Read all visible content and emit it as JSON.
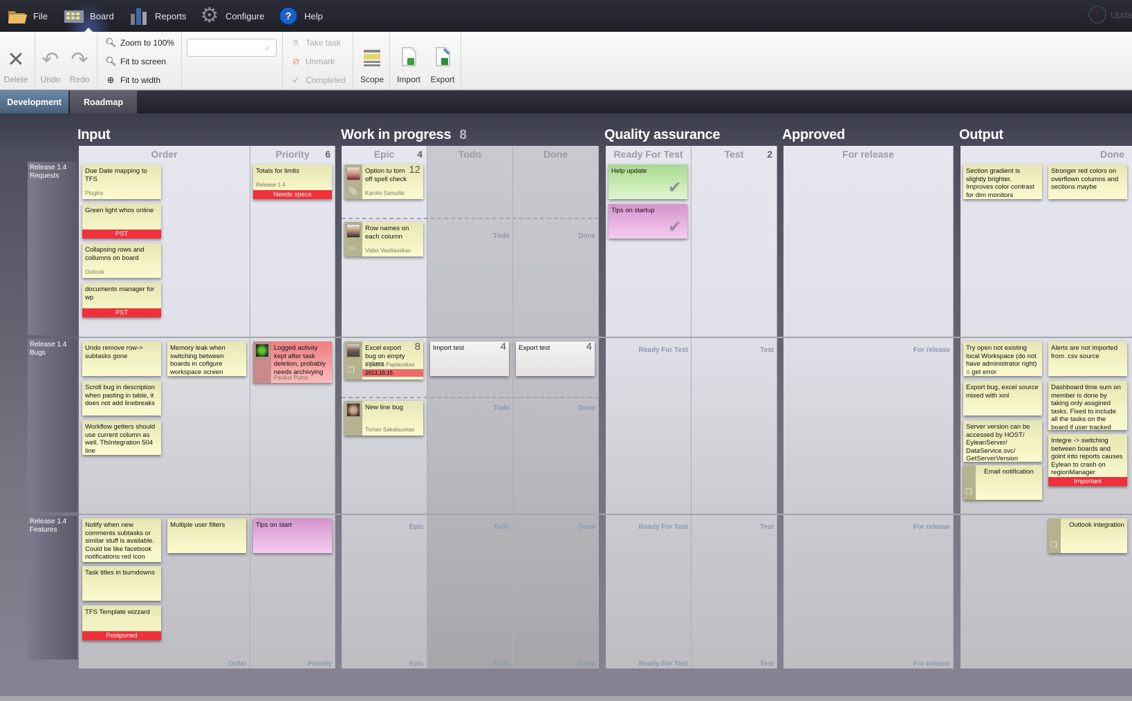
{
  "menu": {
    "items": [
      {
        "label": "File",
        "icon": "folder-icon"
      },
      {
        "label": "Board",
        "icon": "board-icon",
        "active": true
      },
      {
        "label": "Reports",
        "icon": "bar-chart-icon"
      },
      {
        "label": "Configure",
        "icon": "gear-icon"
      },
      {
        "label": "Help",
        "icon": "help-icon"
      }
    ],
    "update_label": "Upda"
  },
  "toolbar": {
    "delete": "Delete",
    "undo": "Undo",
    "redo": "Redo",
    "zoom_100": "Zoom to 100%",
    "fit_screen": "Fit to screen",
    "fit_width": "Fit to width",
    "search_value": "",
    "search_placeholder": "",
    "take_task": "Take task",
    "unmark": "Unmark",
    "completed": "Completed",
    "scope": "Scope",
    "import": "Import",
    "export": "Export"
  },
  "tabs": [
    {
      "label": "Development",
      "active": true
    },
    {
      "label": "Roadmap",
      "active": false
    }
  ],
  "board": {
    "groups": [
      {
        "title": "Input",
        "count": ""
      },
      {
        "title": "Work in progress",
        "count": "8"
      },
      {
        "title": "Quality assurance",
        "count": ""
      },
      {
        "title": "Approved",
        "count": ""
      },
      {
        "title": "Output",
        "count": ""
      }
    ],
    "columns": [
      {
        "name": "Order",
        "count": ""
      },
      {
        "name": "Priority",
        "count": "6"
      },
      {
        "name": "Epic",
        "count": "4"
      },
      {
        "name": "Todo",
        "count": ""
      },
      {
        "name": "Done",
        "count": ""
      },
      {
        "name": "Ready For Test",
        "count": ""
      },
      {
        "name": "Test",
        "count": "2"
      },
      {
        "name": "For release",
        "count": ""
      },
      {
        "name": "Done",
        "count": ""
      }
    ],
    "lanes": [
      {
        "label": "Release 1.4 Requests"
      },
      {
        "label": "Release 1.4 Bugs"
      },
      {
        "label": "Release 1.4 Features"
      }
    ],
    "cards": {
      "c1": {
        "title": "Due Date mapping to TFS",
        "sub": "Plugins"
      },
      "c2": {
        "title": "Green light whos online",
        "band": "PST"
      },
      "c3": {
        "title": "Collapsing rows and collumns on board",
        "sub": "Outlook"
      },
      "c4": {
        "title": "documents manager for wp",
        "band": "PST"
      },
      "c5": {
        "title": "Totals for limits",
        "sub": "Release 1.4",
        "band": "Needs specs"
      },
      "c6": {
        "title": "Option tu torn off spell check",
        "estimate": "12",
        "assignee": "Karolis Samuilis"
      },
      "c7": {
        "title": "Row names on each column",
        "assignee": "Vidas Vasiliauskas"
      },
      "c8": {
        "title": "Help update"
      },
      "c9": {
        "title": "Tips on startup"
      },
      "c10": {
        "title": "Section gradient is slightly brighter. Improves color contrast for dim monitors"
      },
      "c11": {
        "title": "Stronger red colors on overflown columns and sections maybe"
      },
      "c12": {
        "title": "Undo remove row-> subtasks gone"
      },
      "c13": {
        "title": "Memory leak when switching between boards in cofigure workspace screen"
      },
      "c14": {
        "title": "Scroll bug in description when pasting in table, it does not add linebreaks"
      },
      "c15": {
        "title": "Workflow getters should use current column as well. TfsIntegration 504 line"
      },
      "c16": {
        "title": "Logged activity kept after task deletion, probably needs archivying",
        "assignee": "Paulius Putna"
      },
      "c17": {
        "title": "Excel export bug on empty values",
        "estimate": "8",
        "assignee": "Egidijus Paplauskas",
        "date": "2013.10.15"
      },
      "c18": {
        "title": "Import test",
        "estimate": "4"
      },
      "c19": {
        "title": "Export test",
        "estimate": "4"
      },
      "c20": {
        "title": "New line bug",
        "assignee": "Tomas Sakalauskas"
      },
      "c21": {
        "title": "Try open not existing local  Workspace (do not have administrator right) = get error"
      },
      "c22": {
        "title": "Alerts are not imported from .csv source"
      },
      "c23": {
        "title": "Export bug, excel source mixed with xml"
      },
      "c24": {
        "title": "Dashboard time sum on member is done by taking only assgined tasks. Fixed to include all the tasks on the board if user tracked them"
      },
      "c25": {
        "title": "Server version can be accessed by HOST/ EyleanServer/ DataService.svc/ GetServerVersion"
      },
      "c26": {
        "title": "Integre -> switching between boards and goint into reports causes Eylean to crash on regionManager",
        "band": "Important"
      },
      "c27": {
        "title": "Email notification"
      },
      "c28": {
        "title": "Notify when new comments subtasks or similar stuff is available. Could be like facebook notifications red icon"
      },
      "c29": {
        "title": "Multiple user filters"
      },
      "c30": {
        "title": "Tips on start"
      },
      "c31": {
        "title": "Task titles in burndowns"
      },
      "c32": {
        "title": "TFS Template wizzard",
        "band": "Postponed"
      },
      "c33": {
        "title": "Outlook integration"
      }
    }
  }
}
